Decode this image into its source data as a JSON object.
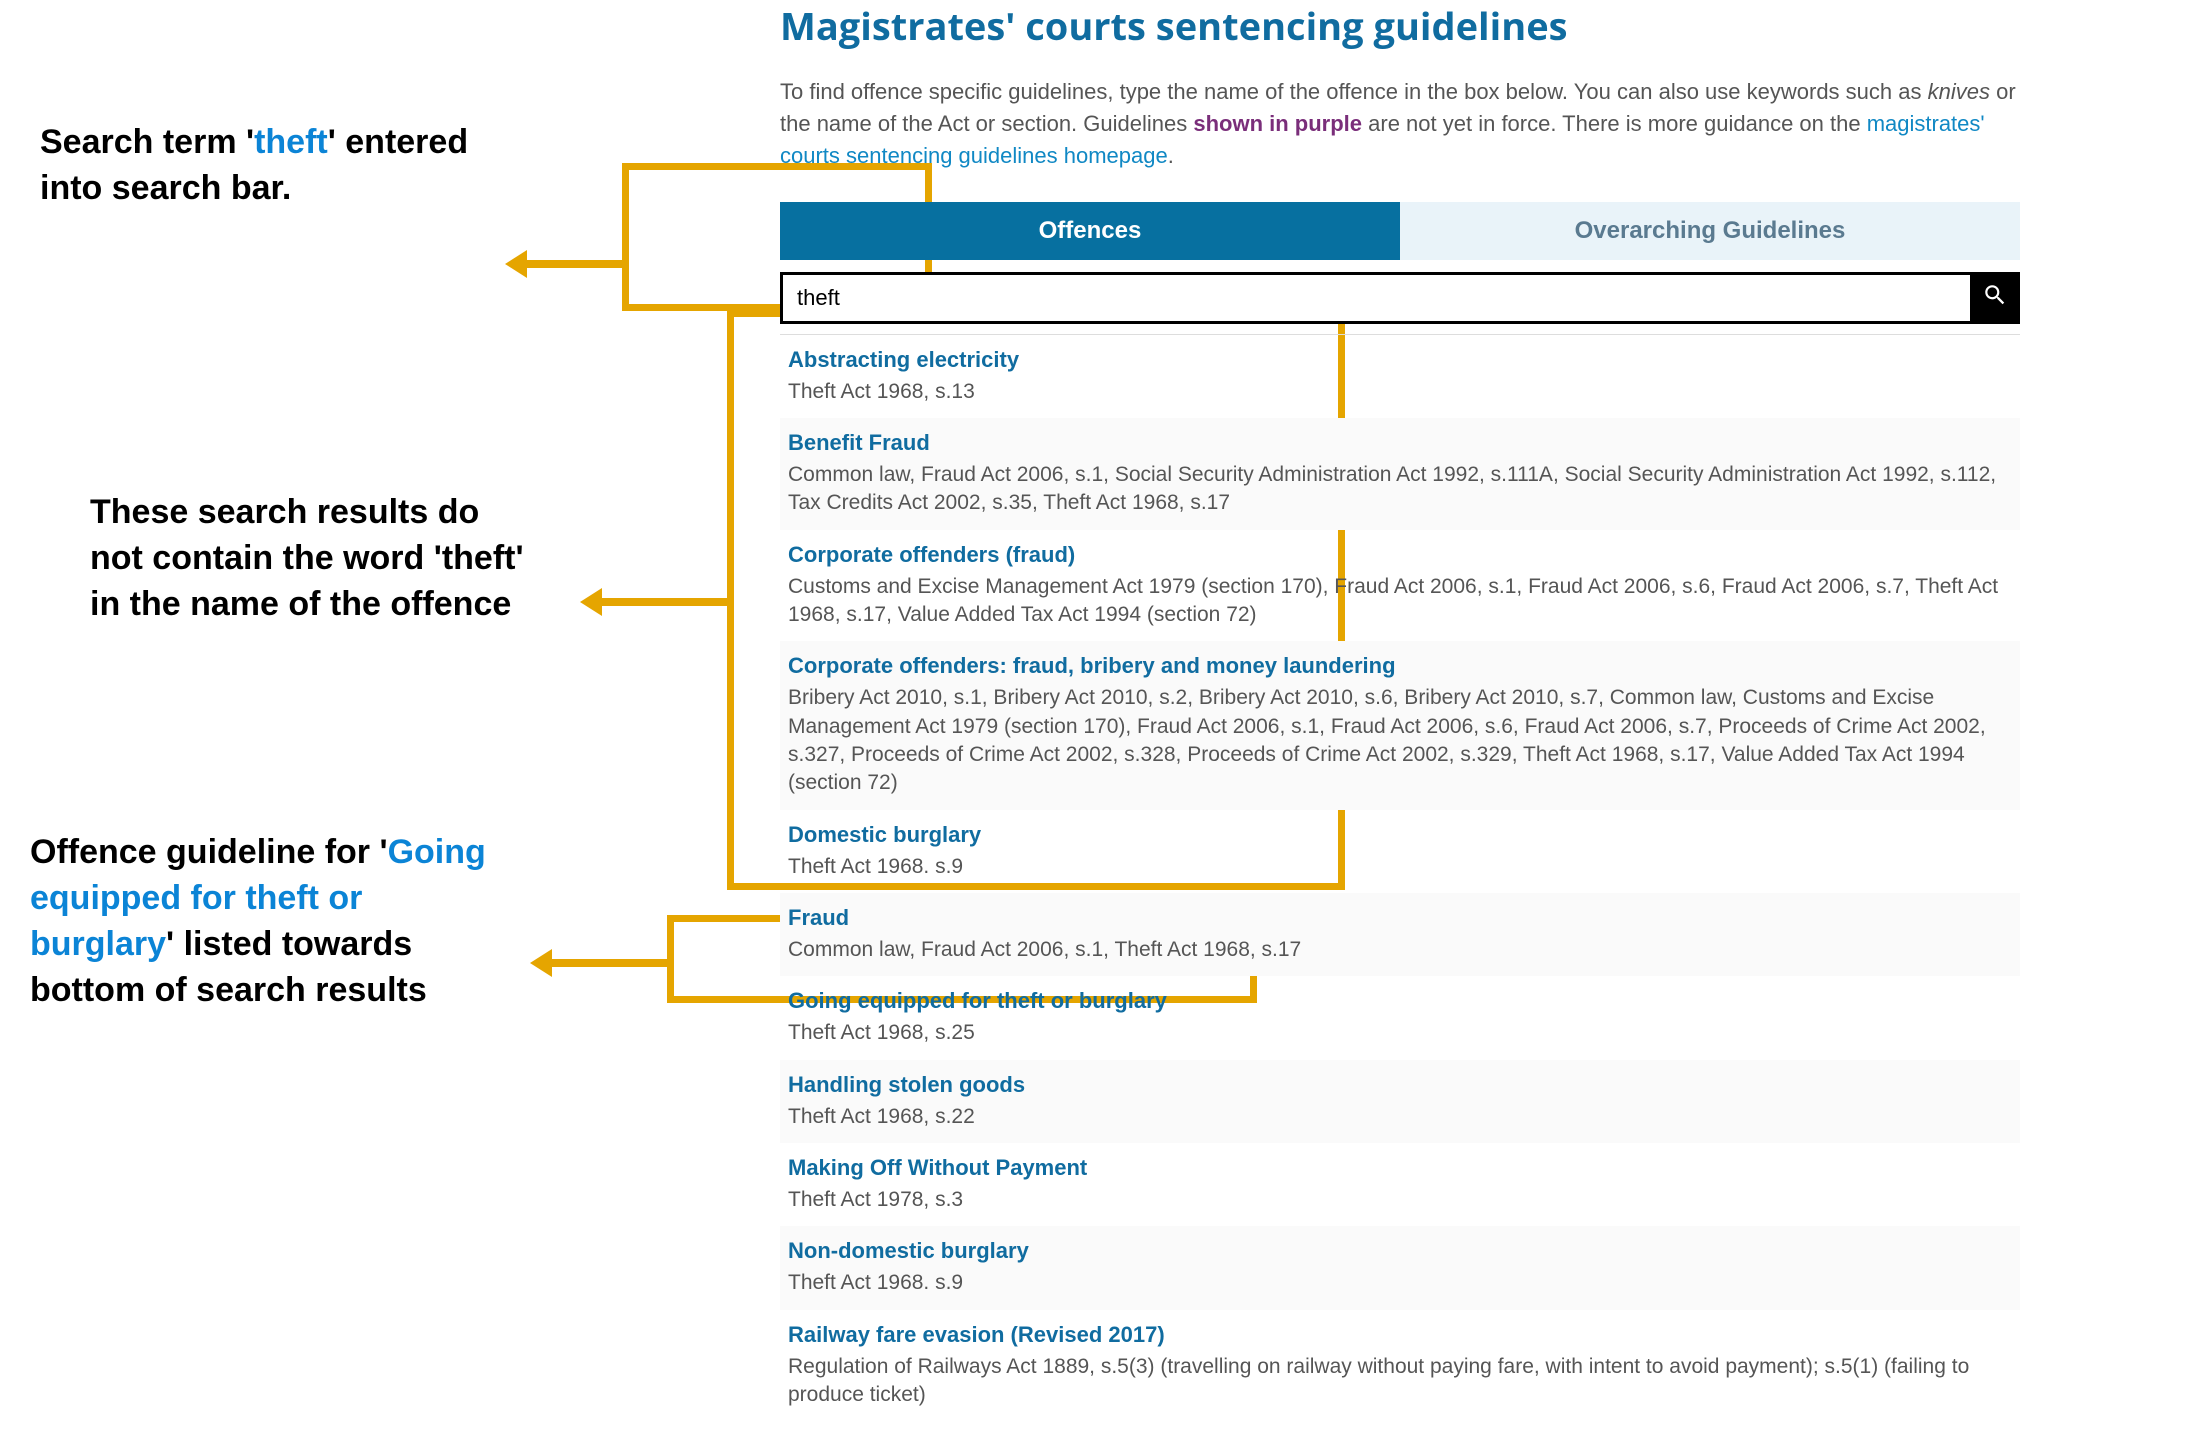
{
  "annotations": {
    "a1_pre": "Search term '",
    "a1_term": "theft",
    "a1_post": "' entered into search bar.",
    "a2": "These search results do not contain the word 'theft' in the name of the offence",
    "a3_pre": "Offence guideline for '",
    "a3_term": "Going equipped for theft or burglary",
    "a3_post": "' listed towards bottom of search results"
  },
  "panel": {
    "title": "Magistrates' courts sentencing guidelines",
    "intro_1": "To find offence specific guidelines, type the name of the offence in the box below. You can also use keywords such as ",
    "intro_italic": "knives",
    "intro_2": " or the name of the Act or section. Guidelines ",
    "intro_purple": "shown in purple",
    "intro_3": " are not yet in force. There is more guidance on the ",
    "intro_link": "magistrates' courts sentencing guidelines homepage",
    "intro_4": "."
  },
  "tabs": {
    "active": "Offences",
    "inactive": "Overarching Guidelines"
  },
  "search": {
    "value": "theft"
  },
  "results": [
    {
      "title": "Abstracting electricity",
      "sub": "Theft Act 1968, s.13"
    },
    {
      "title": "Benefit Fraud",
      "sub": "Common law, Fraud Act 2006, s.1, Social Security Administration Act 1992, s.111A, Social Security Administration Act 1992, s.112, Tax Credits Act 2002, s.35, Theft Act 1968, s.17"
    },
    {
      "title": "Corporate offenders (fraud)",
      "sub": "Customs and Excise Management Act 1979 (section 170), Fraud Act 2006, s.1, Fraud Act 2006, s.6, Fraud Act 2006, s.7, Theft Act 1968, s.17, Value Added Tax Act 1994 (section 72)"
    },
    {
      "title": "Corporate offenders: fraud, bribery and money laundering",
      "sub": "Bribery Act 2010, s.1, Bribery Act 2010, s.2, Bribery Act 2010, s.6, Bribery Act 2010, s.7, Common law, Customs and Excise Management Act 1979 (section 170), Fraud Act 2006, s.1, Fraud Act 2006, s.6, Fraud Act 2006, s.7, Proceeds of Crime Act 2002, s.327, Proceeds of Crime Act 2002, s.328, Proceeds of Crime Act 2002, s.329, Theft Act 1968, s.17, Value Added Tax Act 1994 (section 72)"
    },
    {
      "title": "Domestic burglary",
      "sub": "Theft Act 1968. s.9"
    },
    {
      "title": "Fraud",
      "sub": "Common law, Fraud Act 2006, s.1, Theft Act 1968, s.17"
    },
    {
      "title": "Going equipped for theft or burglary",
      "sub": "Theft Act 1968, s.25"
    },
    {
      "title": "Handling stolen goods",
      "sub": "Theft Act 1968, s.22"
    },
    {
      "title": "Making Off Without Payment",
      "sub": "Theft Act 1978, s.3"
    },
    {
      "title": "Non-domestic burglary",
      "sub": "Theft Act 1968. s.9"
    },
    {
      "title": "Railway fare evasion (Revised 2017)",
      "sub": "Regulation of Railways Act 1889, s.5(3) (travelling on railway without paying fare, with intent to avoid payment); s.5(1) (failing to produce ticket)"
    }
  ]
}
